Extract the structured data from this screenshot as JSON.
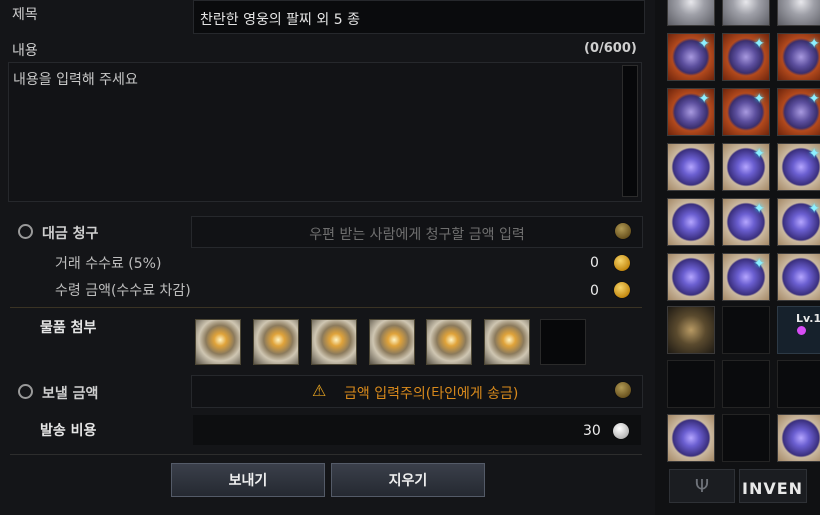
{
  "form": {
    "title_label": "제목",
    "title_value": "찬란한 영웅의 팔찌 외 5 종",
    "content_label": "내용",
    "content_counter": "(0/600)",
    "content_placeholder": "내용을 입력해 주세요",
    "billing": {
      "label": "대금 청구",
      "placeholder": "우편 받는 사람에게 청구할 금액 입력",
      "fee_label": "거래 수수료 (5%)",
      "fee_value": "0",
      "receive_label": "수령 금액(수수료 차감)",
      "receive_value": "0"
    },
    "attach_label": "물품 첨부",
    "send_amount": {
      "label": "보낼 금액",
      "warning": "금액 입력주의(타인에게 송금)"
    },
    "shipping_label": "발송 비용",
    "shipping_value": "30",
    "send_button": "보내기",
    "clear_button": "지우기"
  },
  "attachments": [
    {
      "icon": "bracelet-icon"
    },
    {
      "icon": "bracelet-icon"
    },
    {
      "icon": "bracelet-icon"
    },
    {
      "icon": "bracelet-icon"
    },
    {
      "icon": "bracelet-icon"
    },
    {
      "icon": "bracelet-icon"
    },
    {
      "icon": "empty-slot"
    }
  ],
  "inventory": {
    "level_badge": "Lv.1",
    "watermark": "INVEN"
  },
  "colors": {
    "accent_gold": "#d9a72a",
    "warning": "#d98a1c"
  }
}
